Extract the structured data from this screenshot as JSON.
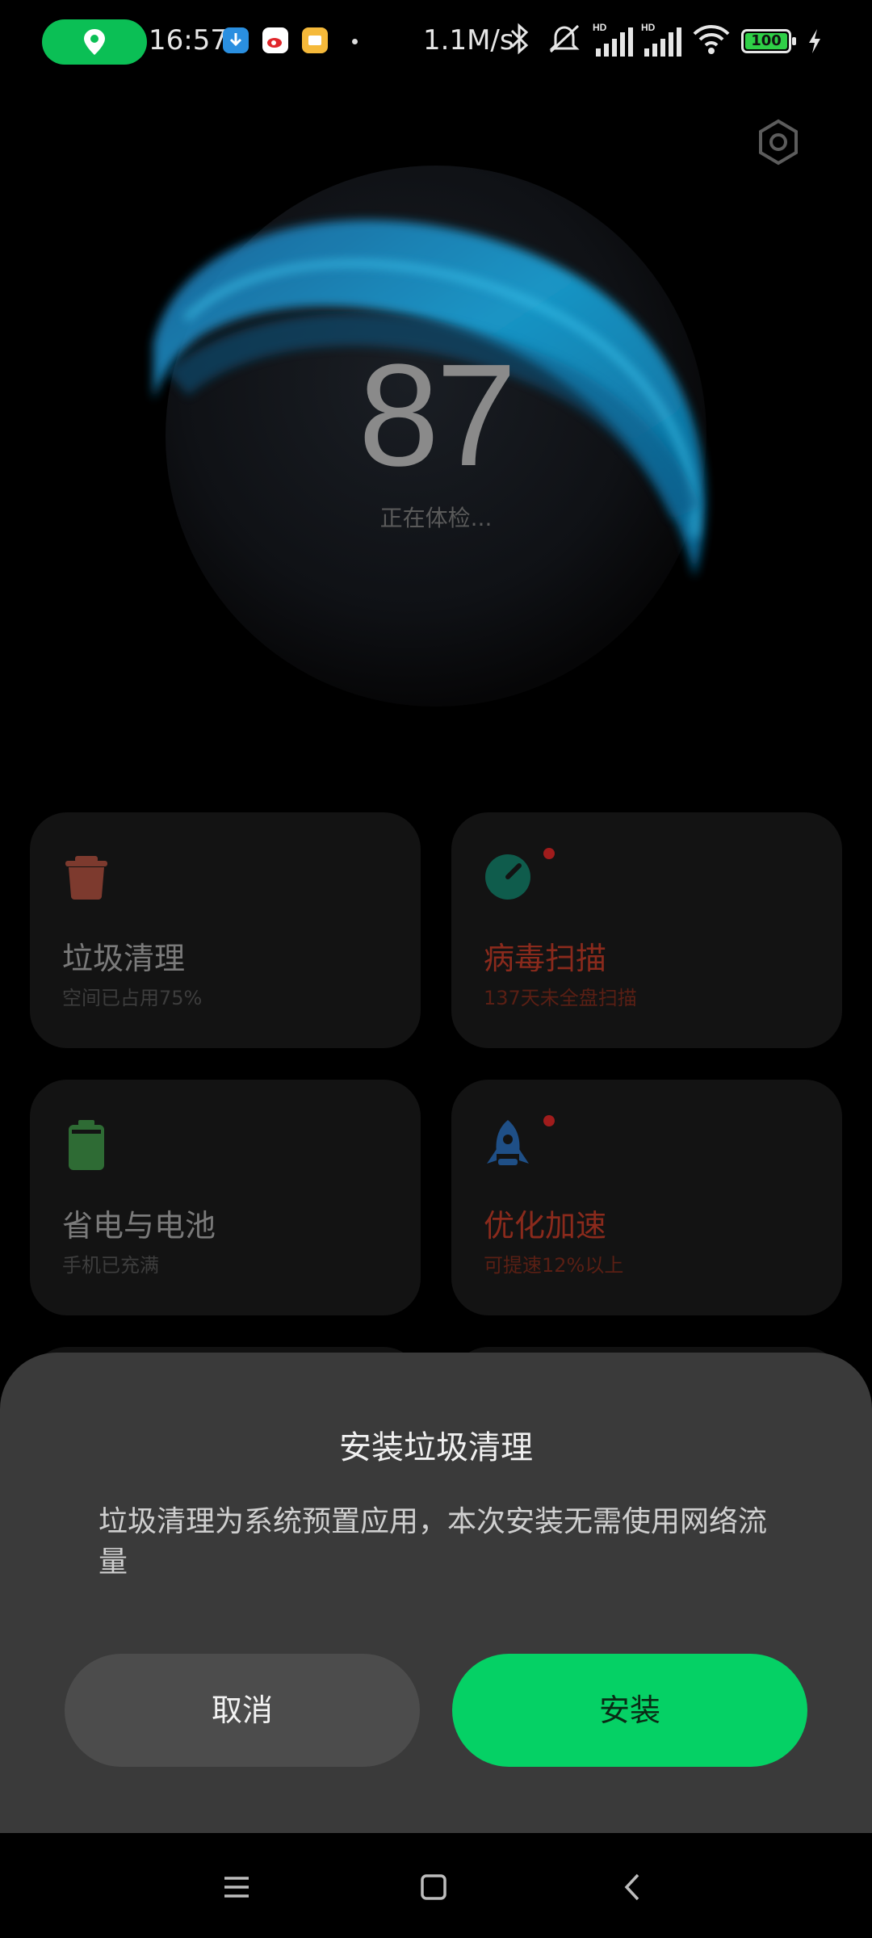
{
  "status_bar": {
    "time": "16:57",
    "net_speed": "1.1M/s",
    "battery": "100",
    "icons": [
      "location-icon",
      "download-app-icon",
      "weibo-app-icon",
      "notes-app-icon",
      "bluetooth-icon",
      "mute-icon",
      "hd-signal-icon",
      "hd-signal-icon",
      "wifi-icon",
      "charging-icon"
    ]
  },
  "header": {
    "settings_icon": "settings-hex-icon"
  },
  "score": {
    "value": "87",
    "status": "正在体检..."
  },
  "cards": [
    {
      "title": "垃圾清理",
      "subtitle": "空间已占用75%",
      "icon": "trash-icon",
      "color": "#7d3a2e"
    },
    {
      "title": "病毒扫描",
      "subtitle": "137天未全盘扫描",
      "icon": "shield-gauge-icon",
      "color": "#0f5c4c"
    },
    {
      "title": "省电与电池",
      "subtitle": "手机已充满",
      "icon": "battery-icon",
      "color": "#2e6b34"
    },
    {
      "title": "优化加速",
      "subtitle": "可提速12%以上",
      "icon": "rocket-icon",
      "color": "#1f4f86"
    }
  ],
  "dialog": {
    "title": "安装垃圾清理",
    "body": "垃圾清理为系统预置应用，本次安装无需使用网络流量",
    "cancel_label": "取消",
    "install_label": "安装"
  },
  "navbar": {
    "icons": [
      "menu-icon",
      "home-icon",
      "back-icon"
    ]
  }
}
